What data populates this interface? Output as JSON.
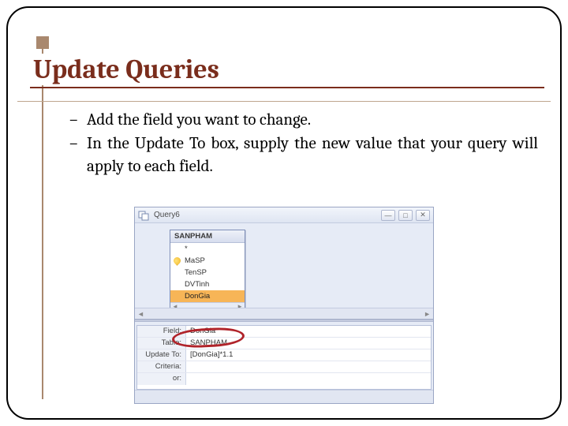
{
  "title": "Update Queries",
  "bullets": [
    "Add the field you want to change.",
    "In the Update To box, supply the new value that your query will apply to each field."
  ],
  "dash": "–",
  "query_window": {
    "title": "Query6",
    "min_glyph": "—",
    "max_glyph": "□",
    "close_glyph": "✕",
    "table": {
      "name": "SANPHAM",
      "star": "*",
      "fields": [
        "MaSP",
        "TenSP",
        "DVTinh",
        "DonGia"
      ],
      "selected_field": "DonGia",
      "scroll_left": "◄",
      "scroll_right": "►"
    },
    "grid": {
      "labels": {
        "field": "Field:",
        "table": "Table:",
        "update_to": "Update To:",
        "criteria": "Criteria:",
        "or": "or:"
      },
      "values": {
        "field": "DonGia",
        "table": "SANPHAM",
        "update_to": "[DonGia]*1.1",
        "criteria": "",
        "or": ""
      }
    },
    "arrow_left": "◄",
    "arrow_right": "►"
  }
}
